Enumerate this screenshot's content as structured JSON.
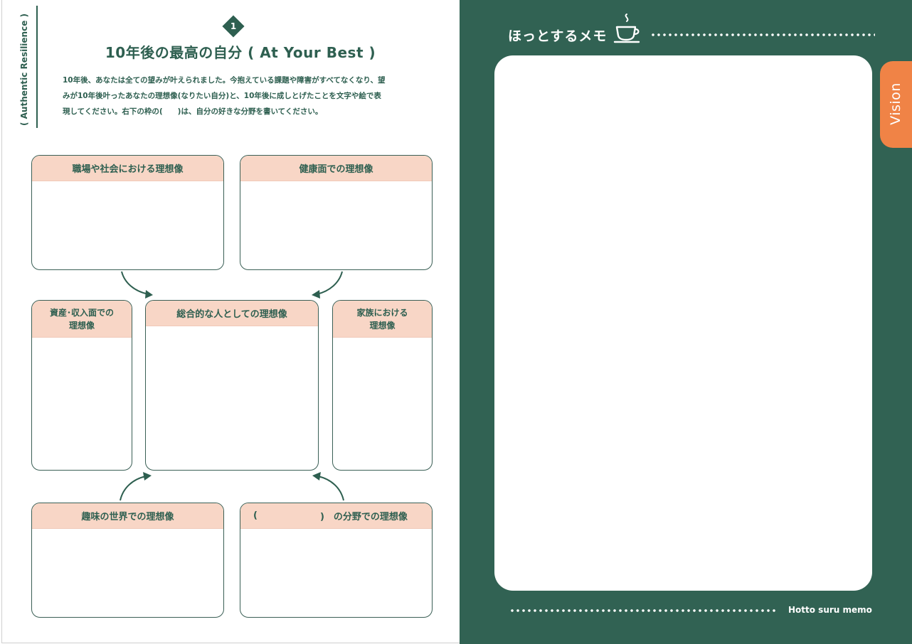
{
  "side_label": "( Authentic Resilience )",
  "section": {
    "number": "1",
    "title": "10年後の最高の自分 ( At Your Best )",
    "intro_lines": [
      "10年後、あなたは全ての望みが叶えられました。今抱えている課題や障害がすべてなくなり、望",
      "みが10年後叶ったあなたの理想像(なりたい自分)と、10年後に成しとげたことを文字や絵で表",
      "現してください。右下の枠の(　　)は、自分の好きな分野を書いてください。"
    ]
  },
  "boxes": {
    "work": "職場や社会における理想像",
    "health": "健康面での理想像",
    "assets_line1": "資産･収入面での",
    "assets_line2": "理想像",
    "overall": "総合的な人としての理想像",
    "family_line1": "家族における",
    "family_line2": "理想像",
    "hobby": "趣味の世界での理想像",
    "custom_open": "(",
    "custom_close": ")　の分野での理想像"
  },
  "memo": {
    "title": "ほっとするメモ",
    "tab_label": "Vision",
    "footer": "Hotto suru memo"
  },
  "colors": {
    "primary_green": "#316253",
    "header_peach": "#f8d6c6",
    "tab_orange": "#f08346"
  },
  "icons": {
    "section_badge": "diamond-number-badge",
    "memo_title": "coffee-cup-icon",
    "arrows": "curved-arrow-icon"
  }
}
